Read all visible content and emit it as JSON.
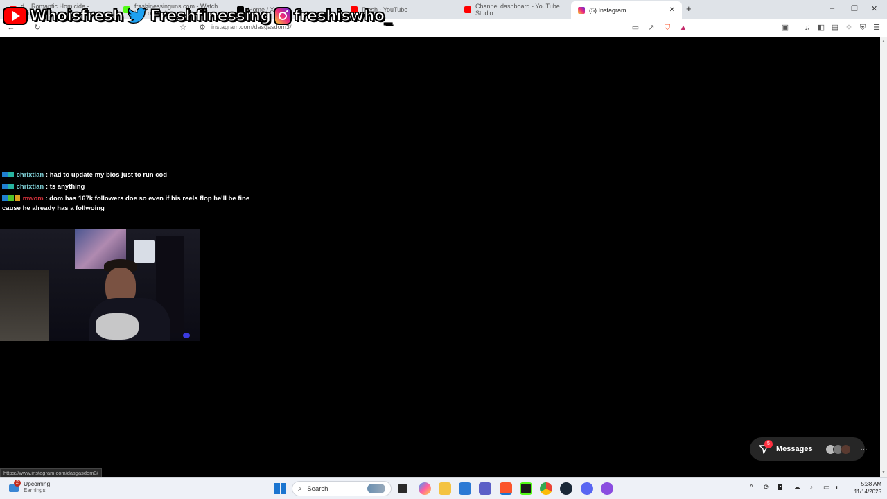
{
  "browser": {
    "tabs": [
      {
        "label": "d... Romantic Homicide - YouTube",
        "favicon_color": "#ff0000"
      },
      {
        "label": "freshinessinguns.com - Watch Live on Kick",
        "favicon_color": "#53fc18"
      },
      {
        "label": "Home / X",
        "favicon_color": "#000000"
      },
      {
        "label": "Fresh - YouTube",
        "favicon_color": "#ff0000"
      },
      {
        "label": "Channel dashboard - YouTube Studio",
        "favicon_color": "#ff0000"
      },
      {
        "label": "(5) Instagram",
        "favicon_color": "#e1306c",
        "active": true
      }
    ],
    "new_tab": "+",
    "url": "instagram.com/dasgasdom3/",
    "window_controls": {
      "minimize": "–",
      "maximize": "❐",
      "close": "✕"
    }
  },
  "overlay": {
    "youtube_handle": "Whoisfresh",
    "twitter_handle": "Freshfinessing",
    "instagram_handle": "freshiswho_"
  },
  "chat": [
    {
      "user": "chrixtian",
      "message": ": had to update my bios just to run cod",
      "user_color": "#7ecfd6"
    },
    {
      "user": "chrixtian",
      "message": ": ts anything",
      "user_color": "#7ecfd6"
    },
    {
      "user": "mwom",
      "message": ": dom has 167k followers doe so even if his reels flop he'll be fine cause he already has a follwoing",
      "user_color": "#d0303a"
    }
  ],
  "status_url": "https://www.instagram.com/dasgasdom3/",
  "messages": {
    "label": "Messages",
    "badge_count": "5",
    "more": "···"
  },
  "taskbar": {
    "widget_title": "Upcoming",
    "widget_subtitle": "Earnings",
    "widget_badge": "2",
    "search_label": "Search",
    "time": "5:38 AM",
    "date": "11/14/2025"
  }
}
